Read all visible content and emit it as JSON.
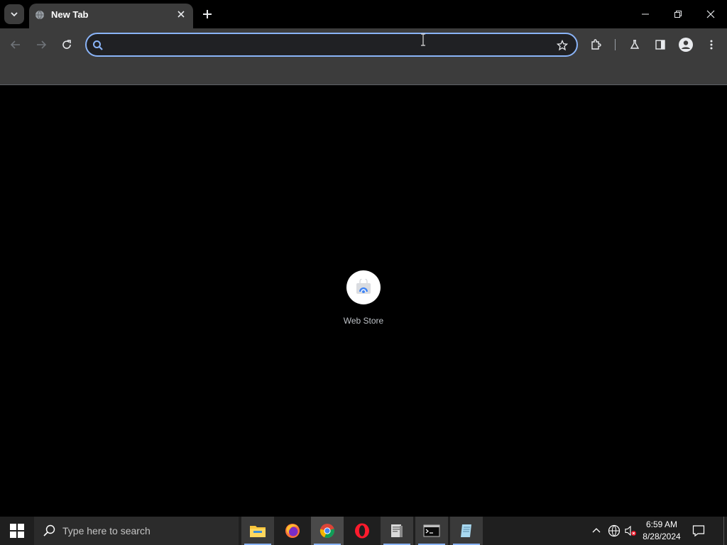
{
  "browser": {
    "tab": {
      "title": "New Tab",
      "favicon": "globe-icon"
    },
    "window_controls": [
      "minimize-icon",
      "restore-icon",
      "close-icon"
    ],
    "toolbar": {
      "omnibox_value": "",
      "omnibox_focused": true,
      "icons": [
        "back-arrow-icon",
        "forward-arrow-icon",
        "reload-icon",
        "bookmark-star-icon",
        "extensions-icon",
        "labs-flask-icon",
        "side-panel-icon",
        "profile-avatar-icon",
        "kebab-menu-icon"
      ]
    }
  },
  "content": {
    "shortcuts": [
      {
        "label": "Web Store",
        "icon": "chrome-web-store-icon"
      }
    ]
  },
  "taskbar": {
    "search_placeholder": "Type here to search",
    "apps": [
      {
        "name": "file-explorer-icon",
        "state": "running"
      },
      {
        "name": "firefox-icon",
        "state": "pinned"
      },
      {
        "name": "chrome-icon",
        "state": "active"
      },
      {
        "name": "opera-icon",
        "state": "pinned"
      },
      {
        "name": "document-viewer-icon",
        "state": "running"
      },
      {
        "name": "terminal-icon",
        "state": "running"
      },
      {
        "name": "notepad-icon",
        "state": "running"
      }
    ],
    "tray": {
      "icons": [
        "chevron-up-icon",
        "globe-network-icon",
        "speaker-muted-icon"
      ],
      "time": "6:59 AM",
      "date": "8/28/2024"
    }
  },
  "colors": {
    "accent": "#8ab4f8",
    "toolbar_bg": "#3c3c3c",
    "page_bg": "#000000",
    "taskbar_bg": "#1f1f1f"
  }
}
